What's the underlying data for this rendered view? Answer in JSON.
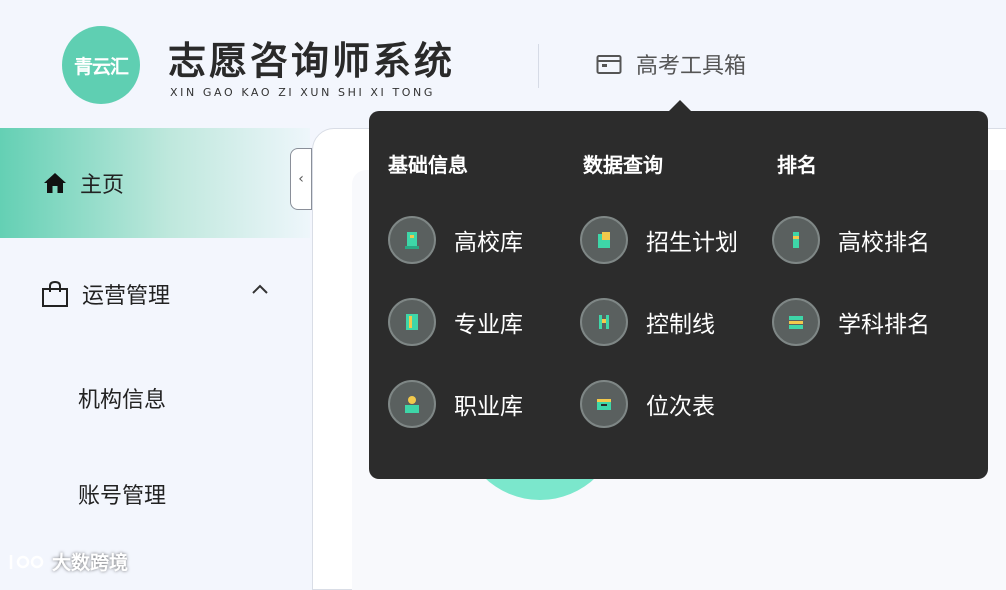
{
  "header": {
    "logo_text": "青云汇",
    "title": "志愿咨询师系统",
    "subtitle": "XIN GAO KAO ZI XUN SHI XI TONG",
    "tools_menu_label": "高考工具箱",
    "tools_icon": "calendar-icon"
  },
  "sidebar": {
    "home_label": "主页",
    "home_icon": "home-icon",
    "ops_label": "运营管理",
    "ops_icon": "shopping-bag-icon",
    "ops_sub_items": [
      "机构信息",
      "账号管理"
    ]
  },
  "dropdown": {
    "columns": [
      {
        "heading": "基础信息",
        "items": [
          "高校库",
          "专业库",
          "职业库"
        ]
      },
      {
        "heading": "数据查询",
        "items": [
          "招生计划",
          "控制线",
          "位次表"
        ]
      },
      {
        "heading": "排名",
        "items": [
          "高校排名",
          "学科排名"
        ]
      }
    ]
  },
  "watermark": "大数跨境",
  "colors": {
    "accent": "#5fcfb2",
    "dropdown_bg": "#2c2c2c",
    "sidebar_bg": "#f3f6fd",
    "icon_green": "#3ed6a8",
    "icon_yellow": "#f2c94c"
  }
}
